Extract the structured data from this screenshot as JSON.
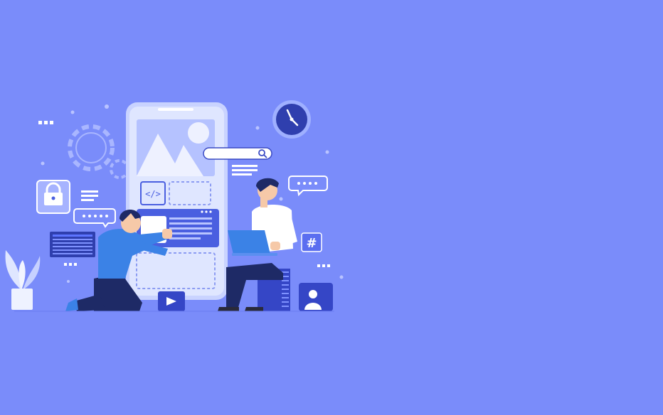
{
  "colors": {
    "background": "#7a8cfa",
    "accent_dark": "#2f3fae",
    "accent_mid": "#4a5fe0",
    "phone_screen": "#dfe6ff",
    "skin": "#f6c9a8",
    "shirt_blue": "#3b82e6",
    "hair": "#1e2a66"
  },
  "icons": [
    "gear-icon",
    "lock-icon",
    "clock-icon",
    "search-icon",
    "code-icon",
    "play-icon",
    "hashtag-icon",
    "user-icon",
    "chat-bubble-icon",
    "image-icon",
    "plant-icon",
    "laptop-icon"
  ],
  "symbols": {
    "code": "</>",
    "hashtag": "#"
  }
}
